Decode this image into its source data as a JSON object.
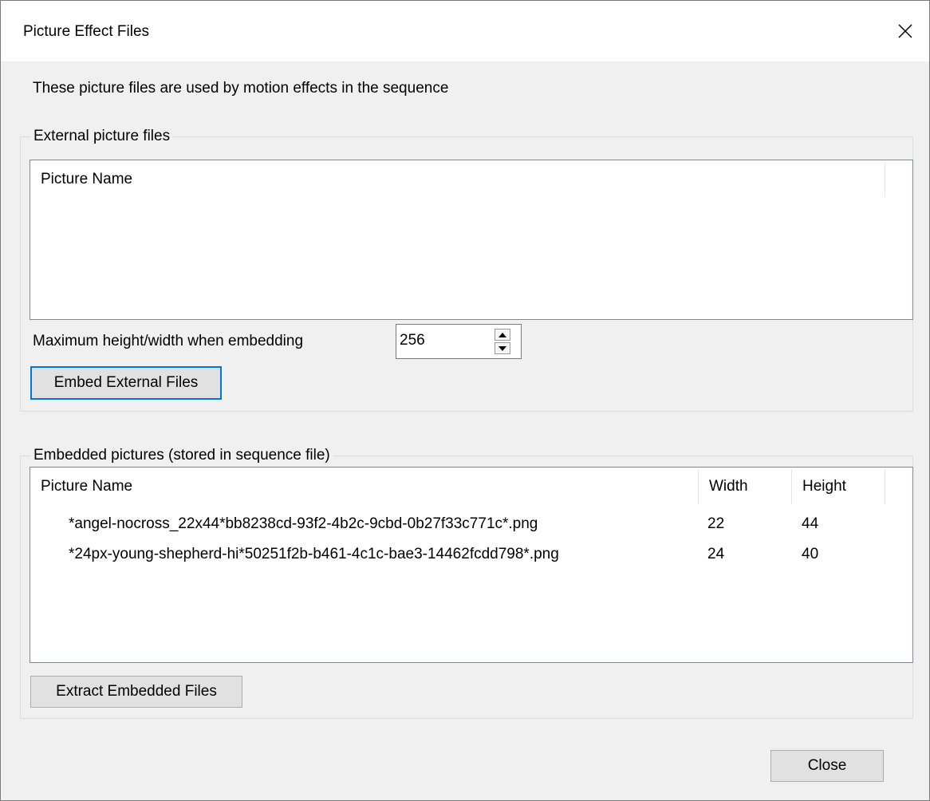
{
  "window": {
    "title": "Picture Effect Files"
  },
  "intro_text": "These picture files are used by motion effects in the sequence",
  "external": {
    "group_label": "External picture files",
    "columns": [
      "Picture Name"
    ],
    "rows": [],
    "max_label": "Maximum height/width when embedding",
    "max_value": "256",
    "embed_button": "Embed External Files"
  },
  "embedded": {
    "group_label": "Embedded pictures (stored in sequence file)",
    "columns": [
      "Picture Name",
      "Width",
      "Height"
    ],
    "rows": [
      {
        "name": "*angel-nocross_22x44*bb8238cd-93f2-4b2c-9cbd-0b27f33c771c*.png",
        "width": "22",
        "height": "44"
      },
      {
        "name": "*24px-young-shepherd-hi*50251f2b-b461-4c1c-bae3-14462fcdd798*.png",
        "width": "24",
        "height": "40"
      }
    ],
    "extract_button": "Extract Embedded Files"
  },
  "close_button": "Close"
}
